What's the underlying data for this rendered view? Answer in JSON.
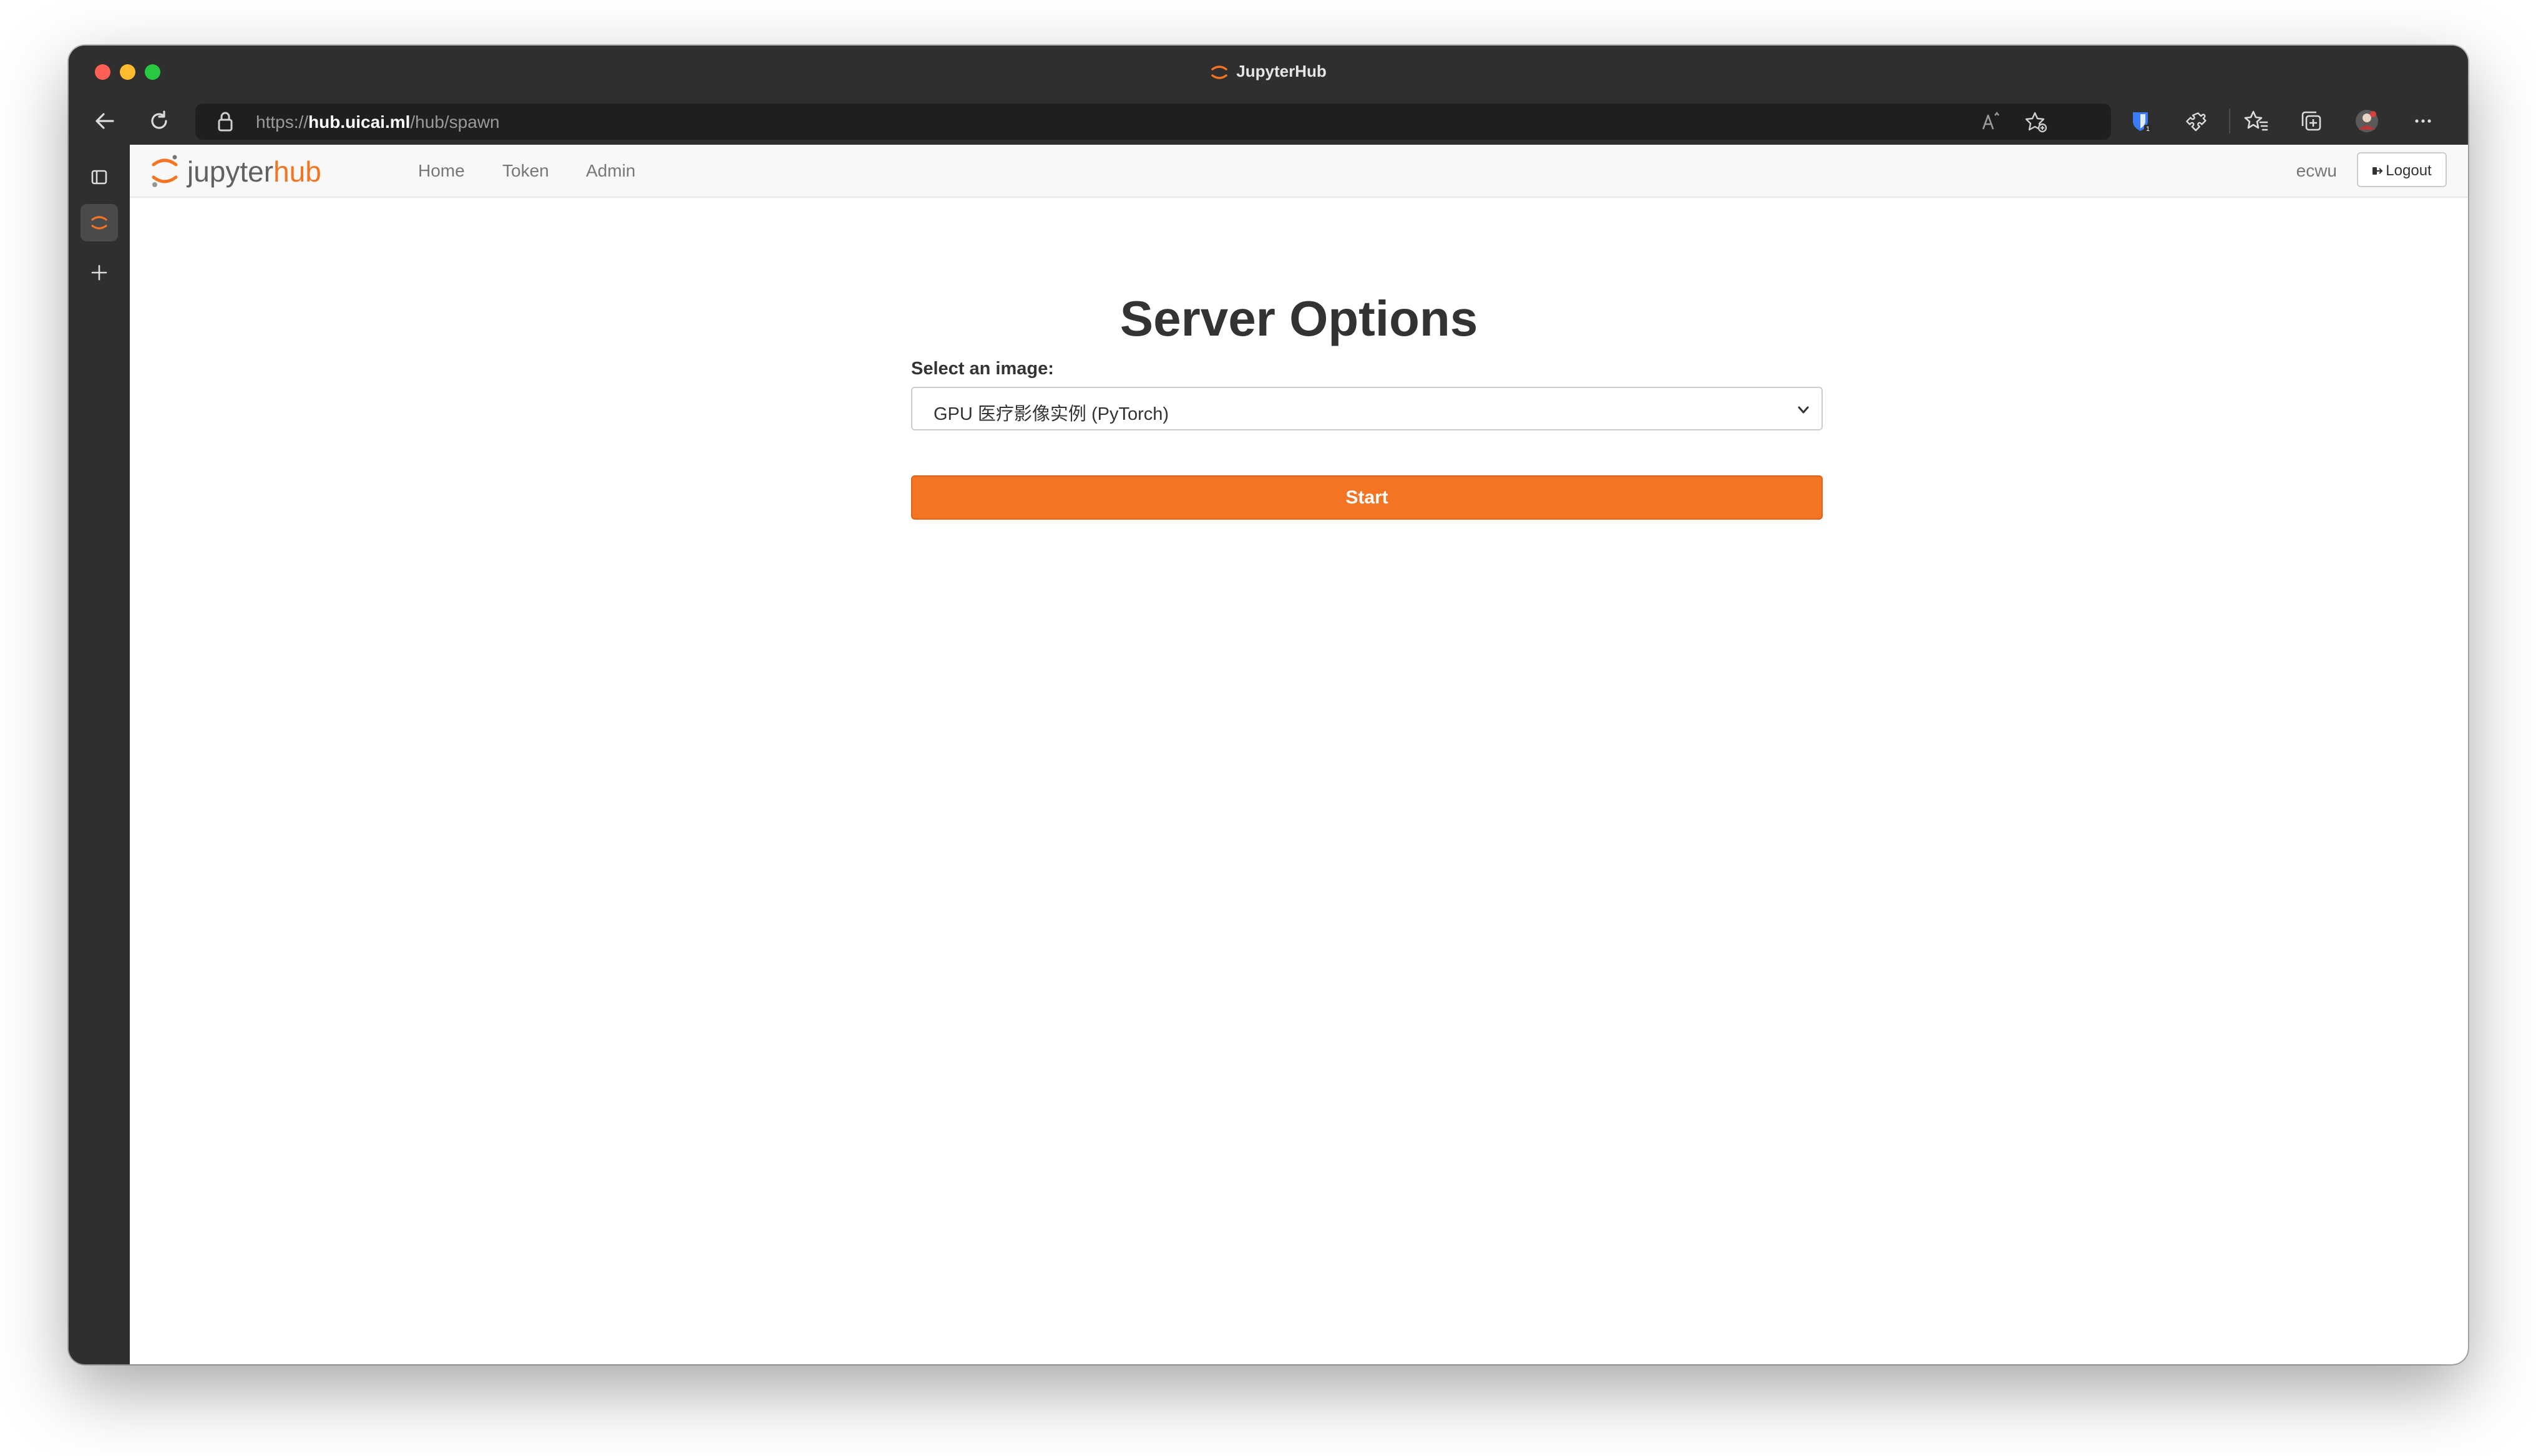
{
  "browser": {
    "tab_title": "JupyterHub",
    "url": {
      "scheme": "https://",
      "host": "hub.uicai.ml",
      "path": "/hub/spawn"
    }
  },
  "navbar": {
    "logo": {
      "jupyter": "jupyter",
      "hub": "hub"
    },
    "links": [
      "Home",
      "Token",
      "Admin"
    ],
    "username": "ecwu",
    "logout_label": "Logout"
  },
  "main": {
    "title": "Server Options",
    "image_label": "Select an image:",
    "image_selected": "GPU 医疗影像实例 (PyTorch)",
    "start_label": "Start"
  },
  "colors": {
    "accent": "#f37524",
    "page_title": "#333333",
    "nav_link": "#777777"
  },
  "icons": [
    "back-arrow-icon",
    "reload-icon",
    "lock-icon",
    "read-aloud-icon",
    "add-favorite-icon",
    "bitwarden-icon",
    "extensions-icon",
    "favorites-icon",
    "collections-icon",
    "profile-avatar",
    "more-icon",
    "tab-sidebar-icon",
    "jupyter-tab-icon",
    "new-tab-icon",
    "logout-icon",
    "chevron-down-icon"
  ]
}
